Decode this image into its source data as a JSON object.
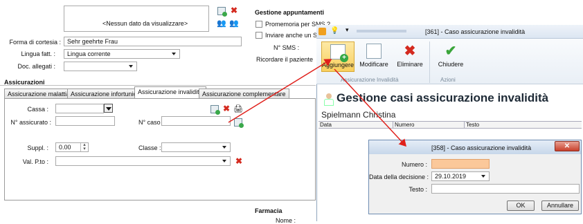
{
  "left": {
    "empty_list_text": "<Nessun dato da visualizzare>",
    "forma_label": "Forma di cortesia :",
    "forma_value": "Sehr geehrte Frau",
    "lingua_label": "Lingua fatt. :",
    "lingua_value": "Lingua corrente",
    "doc_label": "Doc. allegati :",
    "doc_value": "",
    "section_title": "Assicurazioni",
    "tabs": [
      "Assicurazione malattia",
      "Assicurazione infortunio",
      "Assicurazione invalidità",
      "Assicurazione complementare"
    ],
    "cassa_label": "Cassa :",
    "nassicurato_label": "N° assicurato :",
    "ncaso_label": "N° caso :",
    "suppl_label": "Suppl. :",
    "suppl_value": "0.00",
    "classe_label": "Classe :",
    "valpto_label": "Val. P.to :"
  },
  "appointments": {
    "title": "Gestione appuntamenti",
    "sms_reminder": "Promemoria per SMS ?",
    "sms_also": "Inviare anche un SM",
    "nsms_label": "N° SMS :",
    "ricordare": "Ricordare il paziente"
  },
  "farmacia": {
    "title": "Farmacia",
    "nome": "Nome :"
  },
  "window": {
    "title": "[361] - Caso assicurazione invalidità",
    "ribbon_buttons": [
      "Aggiungere",
      "Modificare",
      "Eliminare",
      "Chiudere"
    ],
    "group1": "Assicurazione Invalidità",
    "group2": "Azioni",
    "heading": "Gestione casi assicurazione invalidità",
    "patient": "Spielmann Christina",
    "columns": [
      "Data",
      "Numero",
      "Testo"
    ]
  },
  "dialog": {
    "title": "[358] - Caso assicurazione invalidità",
    "numero_label": "Numero :",
    "numero_value": "",
    "data_label": "Data della decisione :",
    "data_value": "29.10.2019",
    "testo_label": "Testo :",
    "testo_value": "",
    "ok": "OK",
    "cancel": "Annullare"
  },
  "colors": {
    "highlight": "#f8cf5d",
    "numero_field": "#fbc89a",
    "arrow": "#e0201b"
  }
}
